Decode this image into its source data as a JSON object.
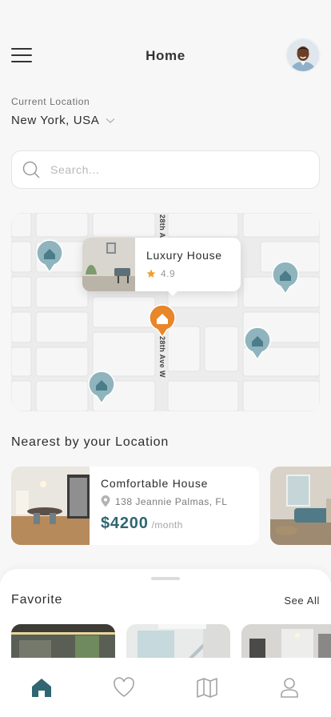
{
  "header": {
    "title": "Home"
  },
  "location": {
    "label": "Current Location",
    "value": "New York, USA"
  },
  "search": {
    "placeholder": "Search..."
  },
  "map": {
    "street_label": "28th Ave W",
    "popup": {
      "title": "Luxury House",
      "rating": "4.9"
    }
  },
  "nearest": {
    "title": "Nearest by your Location",
    "card": {
      "name": "Comfortable House",
      "address": "138 Jeannie Palmas, FL",
      "price": "$4200",
      "unit": "/month"
    }
  },
  "favorite": {
    "title": "Favorite",
    "see_all": "See All"
  },
  "tabs": [
    {
      "name": "home",
      "icon": "home-icon",
      "active": true
    },
    {
      "name": "favorites",
      "icon": "heart-icon",
      "active": false
    },
    {
      "name": "map",
      "icon": "map-icon",
      "active": false
    },
    {
      "name": "profile",
      "icon": "user-icon",
      "active": false
    }
  ],
  "colors": {
    "accent": "#2f6672",
    "pin_active": "#e8862a",
    "pin": "#8fb4bd",
    "star": "#f0a030"
  }
}
